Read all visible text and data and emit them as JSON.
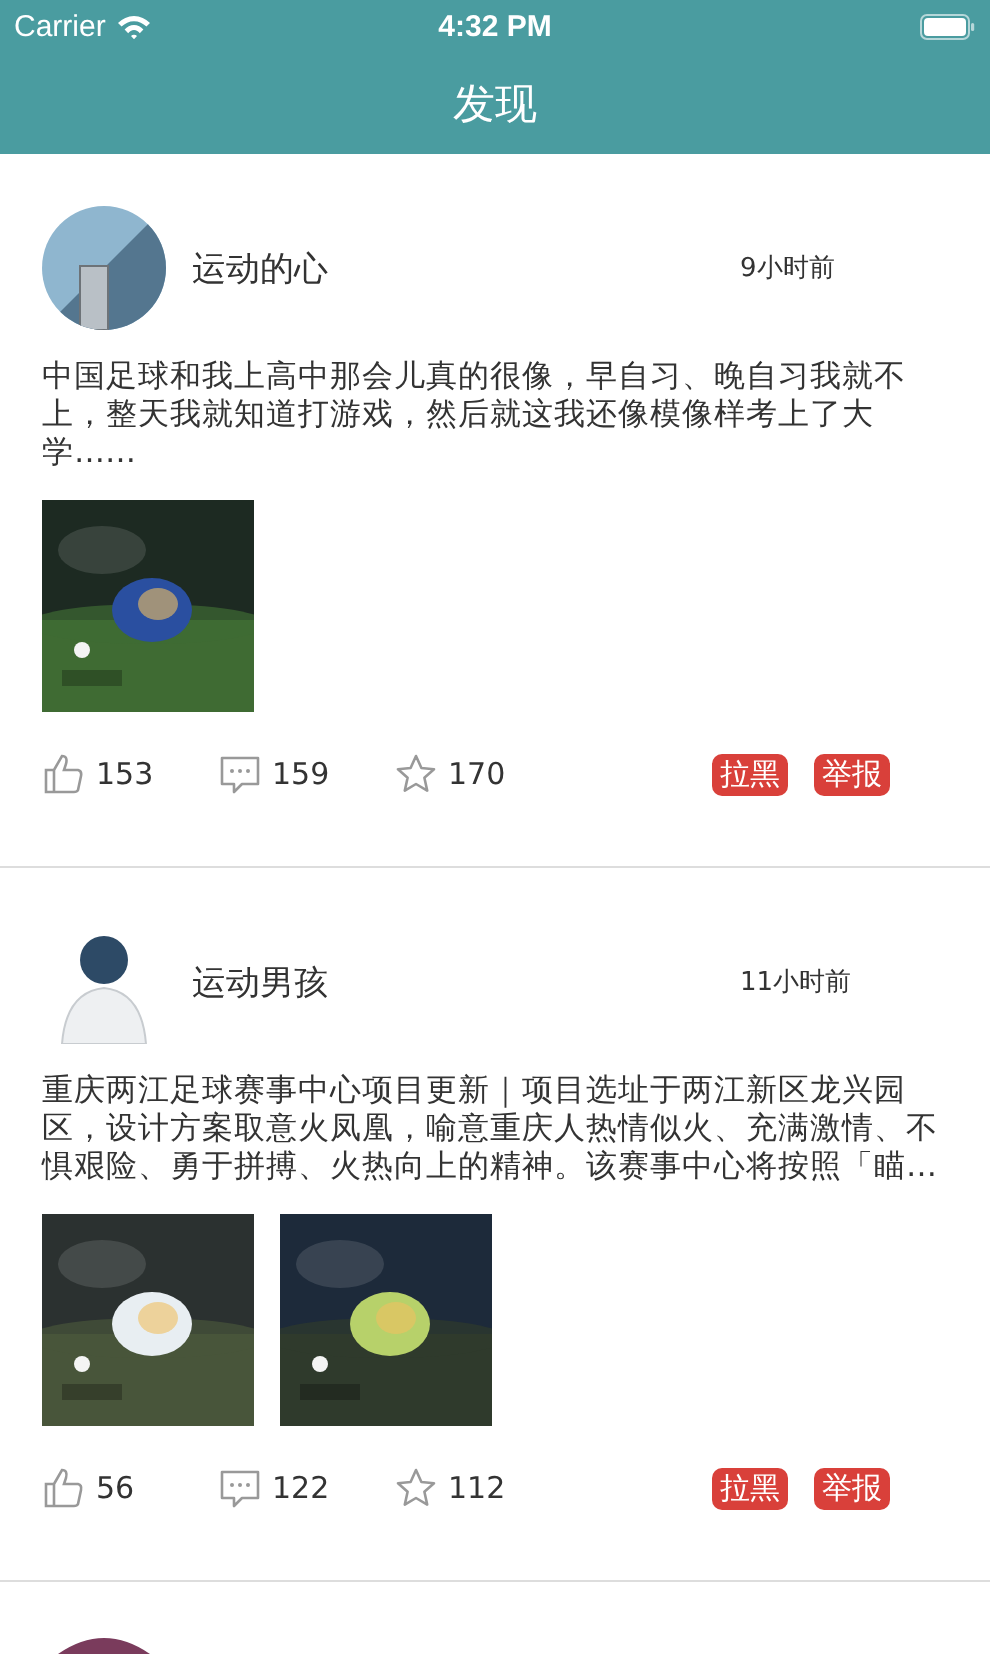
{
  "status_bar": {
    "carrier": "Carrier",
    "time": "4:32 PM"
  },
  "nav": {
    "title": "发现"
  },
  "posts": [
    {
      "author": "运动的心",
      "time": "9小时前",
      "text": "中国足球和我上高中那会儿真的很像，早自习、晚自习我就不上，整天我就知道打游戏，然后就这我还像模像样考上了大学……",
      "likes": "153",
      "comments": "159",
      "favorites": "170",
      "actions": [
        "拉黑",
        "举报"
      ]
    },
    {
      "author": "运动男孩",
      "time": "11小时前",
      "text": "重庆两江足球赛事中心项目更新｜项目选址于两江新区龙兴园区，设计方案取意火凤凰，喻意重庆人热情似火、充满激情、不惧艰险、勇于拼搏、火热向上的精神。该赛事中心将按照「瞄…",
      "likes": "56",
      "comments": "122",
      "favorites": "112",
      "actions": [
        "拉黑",
        "举报"
      ]
    }
  ]
}
